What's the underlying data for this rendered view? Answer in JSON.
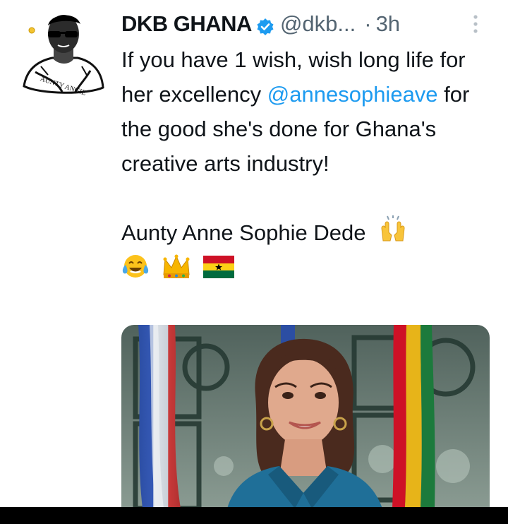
{
  "tweet": {
    "author": {
      "display_name": "DKB GHANA",
      "handle": "@dkb...",
      "verified": true,
      "avatar_text": "AUNTY ANGIE"
    },
    "separator": "·",
    "time": "3h",
    "text": {
      "line1": "If you have 1 wish, wish long life for her excellency",
      "mention": "@annesophieave",
      "line2": " for the good she's done for Ghana's creative arts industry!",
      "signature": "Aunty Anne Sophie Dede"
    },
    "emojis": [
      "raised-hands",
      "crying-laughing",
      "crown",
      "ghana-flag"
    ]
  },
  "colors": {
    "text": "#0f1419",
    "secondary": "#536471",
    "link": "#1d9bf0",
    "verified": "#1d9bf0",
    "ghana_red": "#ce1126",
    "ghana_gold": "#fcd116",
    "ghana_green": "#006b3f"
  }
}
